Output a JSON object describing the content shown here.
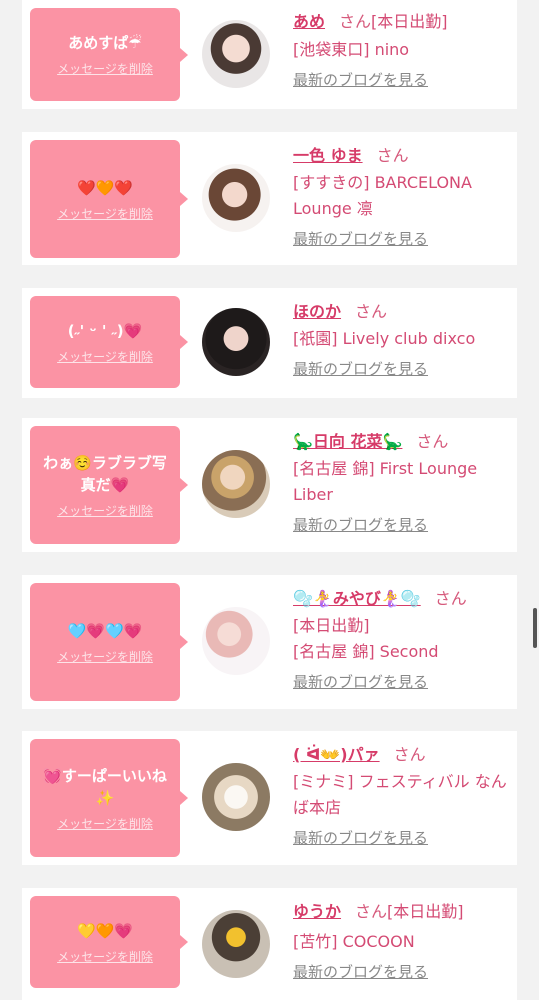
{
  "delete_label": "メッセージを削除",
  "blog_label": "最新のブログを見る",
  "san_label": "さん",
  "items": [
    {
      "message": "あめすぱ☔",
      "name": "あめ",
      "after_san": "[本日出勤]",
      "shop": "[池袋東口] nino"
    },
    {
      "message": "❤️🧡❤️",
      "name": "一色 ゆま",
      "after_san": "",
      "shop": "[すすきの] BARCELONA Lounge 凛"
    },
    {
      "message": "(˶' ᵕ ' ˶)💗",
      "name": "ほのか",
      "after_san": "",
      "shop": "[祇園] Lively club dixco"
    },
    {
      "message": "わぁ☺️ラブラブ写真だ💗",
      "name": "🦕日向 花菜🦕",
      "after_san": "",
      "shop": "[名古屋 錦] First Lounge Liber"
    },
    {
      "message": "🩵💗🩵💗",
      "name": "🫧🧜‍♀️みやび🧜‍♀️🫧",
      "after_san": "",
      "shop": "[本日出勤]\n[名古屋 錦] Second"
    },
    {
      "message": "💓すーぱーいいね✨",
      "name": "( ᐛ👐)パァ",
      "after_san": "",
      "shop": "[ミナミ] フェスティバル なんば本店"
    },
    {
      "message": "💛🧡💗",
      "name": "ゆうか",
      "after_san": "[本日出勤]",
      "shop": "[苫竹] COCOON"
    }
  ],
  "colors": {
    "bubble": "#fb93a4",
    "name": "#d63b68",
    "background": "#f2f2f2"
  }
}
